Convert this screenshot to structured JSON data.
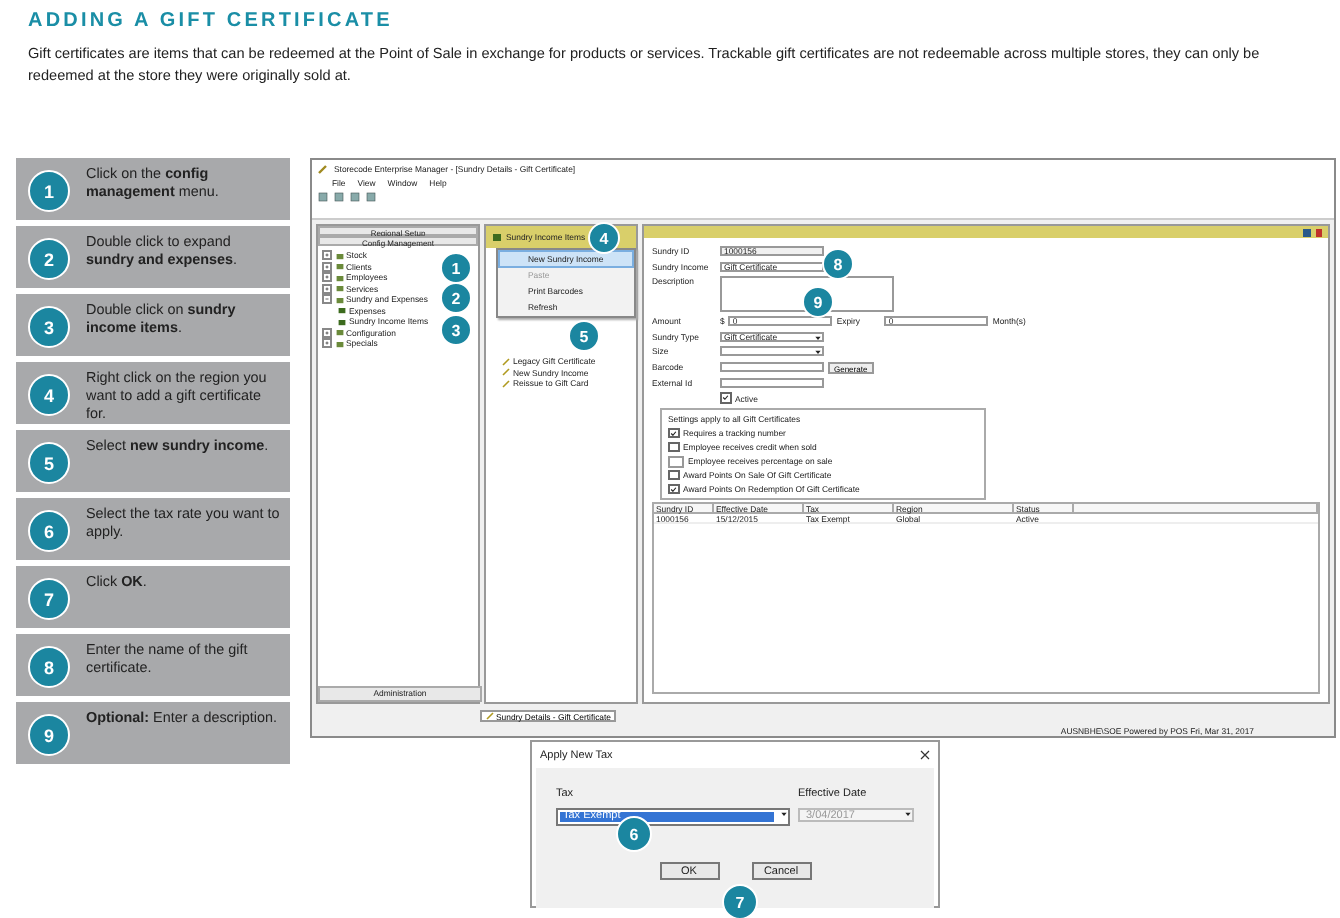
{
  "heading": "ADDING A GIFT CERTIFICATE",
  "intro": "Gift certificates are items that can be redeemed at the Point of Sale in exchange for products or services. Trackable gift certificates are not redeemable across multiple stores, they can only be redeemed at the store they were originally sold at.",
  "steps": [
    {
      "number": "1",
      "text": "Click on the **config management** menu."
    },
    {
      "number": "2",
      "text": "Double click to expand **sundry and expenses**."
    },
    {
      "number": "3",
      "text": "Double click on **sundry income items**."
    },
    {
      "number": "4",
      "text": "Right click on the region you want to add a gift certificate for."
    },
    {
      "number": "5",
      "text": "Select **new sundry income**."
    },
    {
      "number": "6",
      "text": "Select the tax rate you want to apply."
    },
    {
      "number": "7",
      "text": "Click **OK**."
    },
    {
      "number": "8",
      "text": "Enter the name of the gift certificate."
    },
    {
      "number": "9",
      "text": "**Optional:** Enter a description."
    }
  ],
  "app_window": {
    "title": "Storecode Enterprise Manager - [Sundry Details - Gift Certificate]",
    "menu": [
      "File",
      "View",
      "Window",
      "Help"
    ],
    "nav": {
      "buttons": [
        "Regional Setup",
        "Config Management"
      ],
      "tree": [
        {
          "label": "Stock",
          "expanded": false
        },
        {
          "label": "Clients",
          "expanded": false
        },
        {
          "label": "Employees",
          "expanded": false
        },
        {
          "label": "Services",
          "expanded": false
        },
        {
          "label": "Sundry and Expenses",
          "expanded": true,
          "children": [
            {
              "label": "Expenses"
            },
            {
              "label": "Sundry Income Items"
            }
          ]
        },
        {
          "label": "Configuration",
          "expanded": false
        },
        {
          "label": "Specials",
          "expanded": false
        }
      ],
      "footer": "Administration"
    },
    "region_panel": {
      "header": "Sundry Income Items",
      "items": [
        "Legacy Gift Certificate",
        "New Sundry Income",
        "Reissue to Gift Card"
      ]
    },
    "context_menu": [
      {
        "label": "New Sundry Income",
        "selected": true,
        "disabled": false
      },
      {
        "label": "Paste",
        "selected": false,
        "disabled": true
      },
      {
        "label": "Print Barcodes",
        "selected": false,
        "disabled": false
      },
      {
        "label": "Refresh",
        "selected": false,
        "disabled": false
      }
    ],
    "form": {
      "sundry_id_label": "Sundry ID",
      "sundry_id": "1000156",
      "name_label": "Sundry Income",
      "name": "Gift Certificate",
      "description_label": "Description",
      "amount_label": "Amount",
      "currency": "$",
      "amount": "0",
      "extra_label": "Expiry",
      "extra": "0",
      "months_label": "Month(s)",
      "type_label": "Sundry Type",
      "type": "Gift Certificate",
      "size_label": "Size",
      "barcode_label": "Barcode",
      "generate_button": "Generate",
      "external_label": "External Id",
      "active": {
        "label": "Active",
        "checked": true
      },
      "settings_title": "Settings apply to all Gift Certificates",
      "settings": [
        {
          "kind": "checkbox",
          "label": "Requires a tracking number",
          "checked": true
        },
        {
          "kind": "checkbox",
          "label": "Employee receives credit when sold",
          "checked": false
        },
        {
          "kind": "percent",
          "label": "Employee receives percentage on sale"
        },
        {
          "kind": "checkbox",
          "label": "Award Points On Sale Of Gift Certificate",
          "checked": false
        },
        {
          "kind": "checkbox",
          "label": "Award Points On Redemption Of Gift Certificate",
          "checked": true
        }
      ]
    },
    "table": {
      "columns": [
        "Sundry ID",
        "Effective Date",
        "Tax",
        "Region",
        "Status"
      ],
      "rows": [
        [
          "1000156",
          "15/12/2015",
          "Tax Exempt",
          "Global",
          "Active"
        ]
      ]
    },
    "tab": "Sundry Details - Gift Certificate",
    "status": "AUSNBHE\\SOE Powered by POS Fri, Mar 31, 2017",
    "callouts": [
      "1",
      "2",
      "3",
      "4",
      "5",
      "8",
      "9"
    ]
  },
  "dialog": {
    "title": "Apply New Tax",
    "tax_label": "Tax",
    "tax_value": "Tax Exempt",
    "date_label": "Effective Date",
    "date_value": "3/04/2017",
    "date_disabled": true,
    "buttons": [
      "OK",
      "Cancel"
    ],
    "callouts": [
      "6",
      "7"
    ]
  }
}
